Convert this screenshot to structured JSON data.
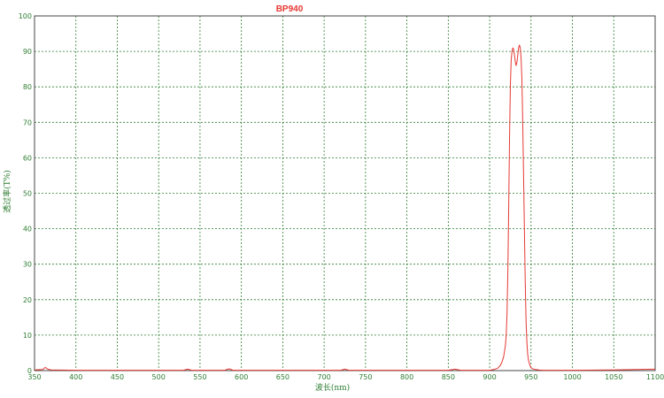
{
  "chart_data": {
    "type": "line",
    "title": "BP940",
    "xlabel": "波长(nm)",
    "ylabel": "透过率(T%)",
    "xlim": [
      350,
      1100
    ],
    "ylim": [
      0,
      100
    ],
    "x_ticks": [
      350,
      400,
      450,
      500,
      550,
      600,
      650,
      700,
      750,
      800,
      850,
      900,
      950,
      1000,
      1050,
      1100
    ],
    "y_ticks": [
      0,
      10,
      20,
      30,
      40,
      50,
      60,
      70,
      80,
      90,
      100
    ],
    "grid": true,
    "colors": {
      "series": "#e53935",
      "grid": "#2e7d32",
      "axis": "#444444",
      "text": "#2e7d32",
      "title": "#e53935"
    },
    "series": [
      {
        "x": [
          350,
          360,
          363,
          366,
          370,
          400,
          450,
          500,
          530,
          535,
          540,
          580,
          585,
          590,
          600,
          650,
          700,
          720,
          725,
          730,
          760,
          800,
          850,
          858,
          865,
          880,
          900,
          905,
          910,
          913,
          915,
          917,
          919,
          920,
          921,
          922,
          923,
          924,
          925,
          926,
          927,
          928,
          929,
          930,
          931,
          932,
          933,
          934,
          935,
          936,
          937,
          938,
          939,
          940,
          941,
          942,
          943,
          944,
          945,
          946,
          947,
          948,
          949,
          950,
          952,
          955,
          960,
          965,
          970,
          980,
          1000,
          1050,
          1100
        ],
        "y": [
          0.2,
          0.3,
          0.9,
          0.4,
          0.2,
          0.1,
          0.1,
          0.1,
          0.1,
          0.4,
          0.1,
          0.1,
          0.5,
          0.1,
          0.1,
          0.1,
          0.1,
          0.1,
          0.4,
          0.1,
          0.1,
          0.1,
          0.1,
          0.4,
          0.1,
          0.1,
          0.1,
          0.3,
          0.7,
          1.5,
          2.5,
          4.0,
          7.0,
          10.0,
          16.0,
          28.0,
          45.0,
          65.0,
          80.0,
          87.5,
          90.0,
          91.0,
          90.5,
          89.0,
          87.0,
          86.0,
          87.0,
          89.0,
          91.0,
          91.8,
          91.0,
          88.0,
          82.0,
          70.0,
          55.0,
          40.0,
          25.0,
          14.0,
          8.0,
          4.5,
          2.8,
          2.0,
          1.3,
          0.8,
          0.5,
          0.3,
          0.15,
          0.1,
          0.1,
          0.1,
          0.1,
          0.2,
          0.4
        ]
      }
    ]
  }
}
